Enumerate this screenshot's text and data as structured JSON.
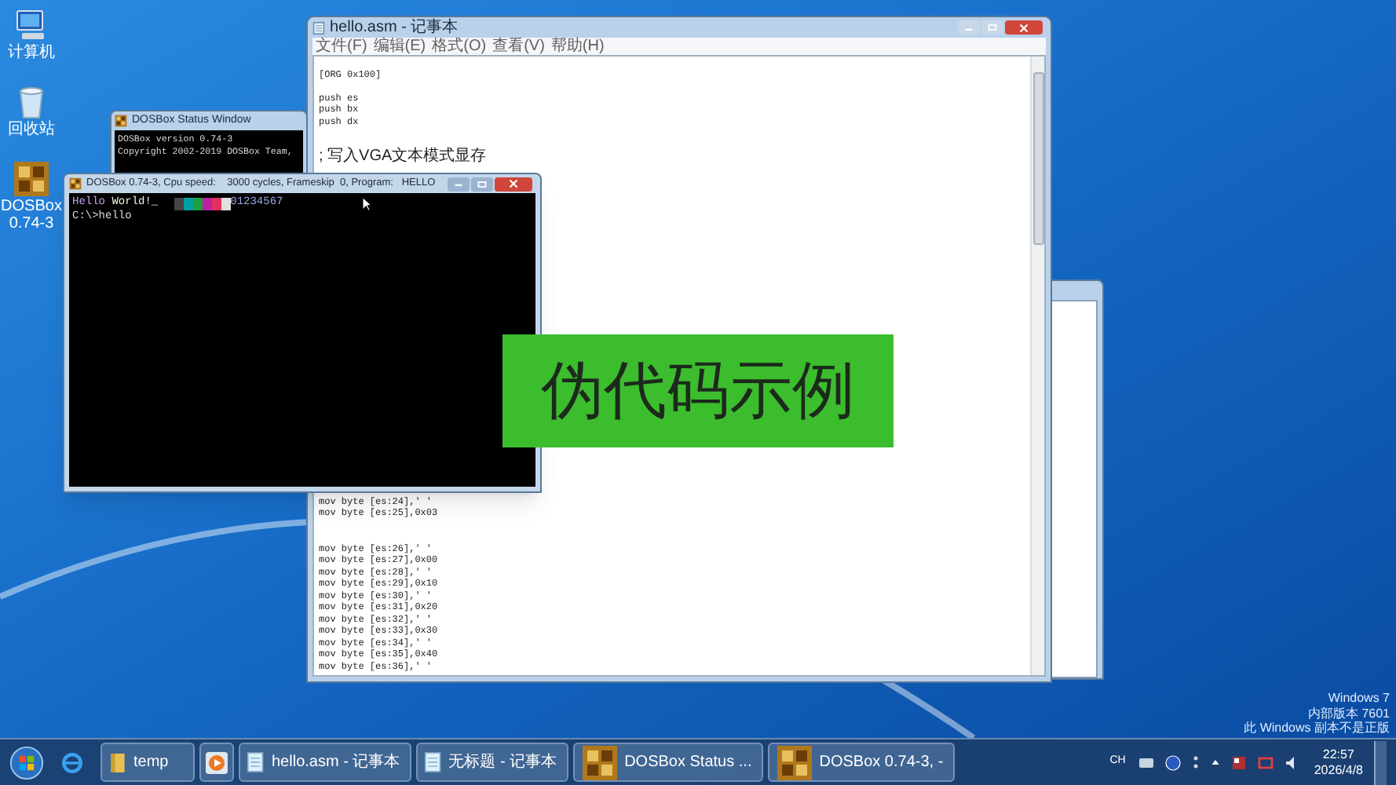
{
  "desktop_icons": [
    {
      "label": "计算机",
      "kind": "computer"
    },
    {
      "label": "回收站",
      "kind": "recycle_bin"
    },
    {
      "label": "DOSBox 0.74-3",
      "kind": "dosbox"
    }
  ],
  "status_window": {
    "title": "DOSBox Status Window",
    "lines": [
      "DOSBox version 0.74-3",
      "Copyright 2002-2019 DOSBox Team,"
    ]
  },
  "notepad": {
    "title": "hello.asm - 记事本",
    "menu": [
      "文件(F)",
      "编辑(E)",
      "格式(O)",
      "查看(V)",
      "帮助(H)"
    ],
    "groups_top": [
      [
        "[ORG 0x100]"
      ],
      [
        "push es",
        "push bx",
        "push dx"
      ]
    ],
    "comment": "; 写入VGA文本模式显存",
    "groups_bottom": [
      [
        "mov byte [es:24],' '",
        "mov byte [es:25],0x03"
      ],
      [
        "mov byte [es:26],' '",
        "mov byte [es:27],0x00",
        "mov byte [es:28],' '",
        "mov byte [es:29],0x10",
        "mov byte [es:30],' '",
        "mov byte [es:31],0x20",
        "mov byte [es:32],' '",
        "mov byte [es:33],0x30",
        "mov byte [es:34],' '",
        "mov byte [es:35],0x40",
        "mov byte [es:36],' '"
      ]
    ]
  },
  "dosbox": {
    "title": "DOSBox 0.74-3, Cpu speed:    3000 cycles, Frameskip  0, Program:   HELLO",
    "output": [
      {
        "text": "Hello",
        "color": "#c8a0f0"
      },
      {
        "text": " World!_",
        "color": "#e8f8e0"
      }
    ],
    "blocks": [
      {
        "color": "#444444"
      },
      {
        "color": "#00a0a0"
      },
      {
        "color": "#20a040"
      },
      {
        "color": "#c020a0"
      },
      {
        "color": "#e03060"
      },
      {
        "color": "#e0e0e0"
      }
    ],
    "digits": {
      "text": "01234567",
      "color": "#9aa8e0"
    },
    "prompt": "C:\\>hello"
  },
  "overlay": {
    "text": "伪代码示例"
  },
  "windows_notice": [
    "Windows 7",
    "内部版本 7601",
    "此 Windows 副本不是正版"
  ],
  "taskbar": {
    "buttons": [
      {
        "label": "temp",
        "kind": "folder"
      },
      {
        "kind": "media"
      },
      {
        "label": "hello.asm - 记事本",
        "kind": "notepad"
      },
      {
        "label": "无标题 - 记事本",
        "kind": "notepad"
      },
      {
        "label": "DOSBox Status ...",
        "kind": "dosbox"
      },
      {
        "label": "DOSBox 0.74-3, -",
        "kind": "dosbox"
      }
    ],
    "language": "CH",
    "time": "22:57",
    "date": "2026/4/8"
  }
}
